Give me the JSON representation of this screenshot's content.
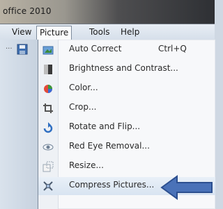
{
  "window": {
    "title": "office 2010"
  },
  "menubar": {
    "view": "View",
    "picture": "Picture",
    "tools": "Tools",
    "help": "Help"
  },
  "menu_items": [
    {
      "label": "Auto Correct",
      "shortcut": "Ctrl+Q",
      "icon": "auto-correct-icon"
    },
    {
      "label": "Brightness and Contrast...",
      "icon": "brightness-contrast-icon"
    },
    {
      "label": "Color...",
      "icon": "color-icon"
    },
    {
      "label": "Crop...",
      "icon": "crop-icon"
    },
    {
      "label": "Rotate and Flip...",
      "icon": "rotate-flip-icon"
    },
    {
      "label": "Red Eye Removal...",
      "icon": "red-eye-icon"
    },
    {
      "label": "Resize...",
      "icon": "resize-icon"
    },
    {
      "label": "Compress Pictures...",
      "icon": "compress-icon"
    }
  ],
  "colors": {
    "arrow": "#4a72b8",
    "highlight": "#d8e4f1"
  }
}
